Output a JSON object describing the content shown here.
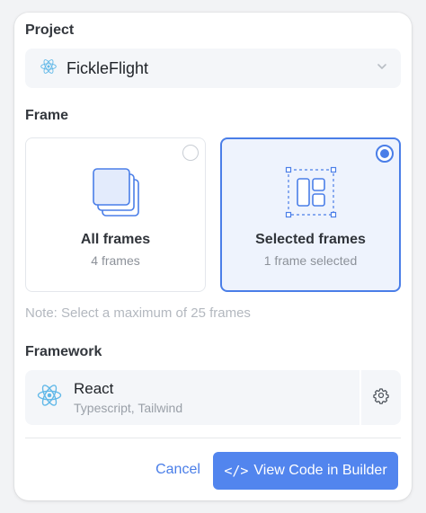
{
  "project": {
    "label": "Project",
    "selected_name": "FickleFlight",
    "icon": "react-icon"
  },
  "frame": {
    "label": "Frame",
    "options": [
      {
        "title": "All frames",
        "subtitle": "4 frames",
        "selected": false,
        "icon": "stacked-frames-icon"
      },
      {
        "title": "Selected frames",
        "subtitle": "1 frame selected",
        "selected": true,
        "icon": "selected-frame-icon"
      }
    ],
    "note": "Note: Select a maximum of 25 frames"
  },
  "framework": {
    "label": "Framework",
    "name": "React",
    "details": "Typescript, Tailwind",
    "icon": "react-icon",
    "settings_icon": "gear-icon"
  },
  "actions": {
    "cancel_label": "Cancel",
    "primary_icon": "</>",
    "primary_label": "View Code in Builder"
  },
  "colors": {
    "accent": "#5285ee",
    "selected_bg": "#eef3fd",
    "react": "#61b8e8"
  }
}
